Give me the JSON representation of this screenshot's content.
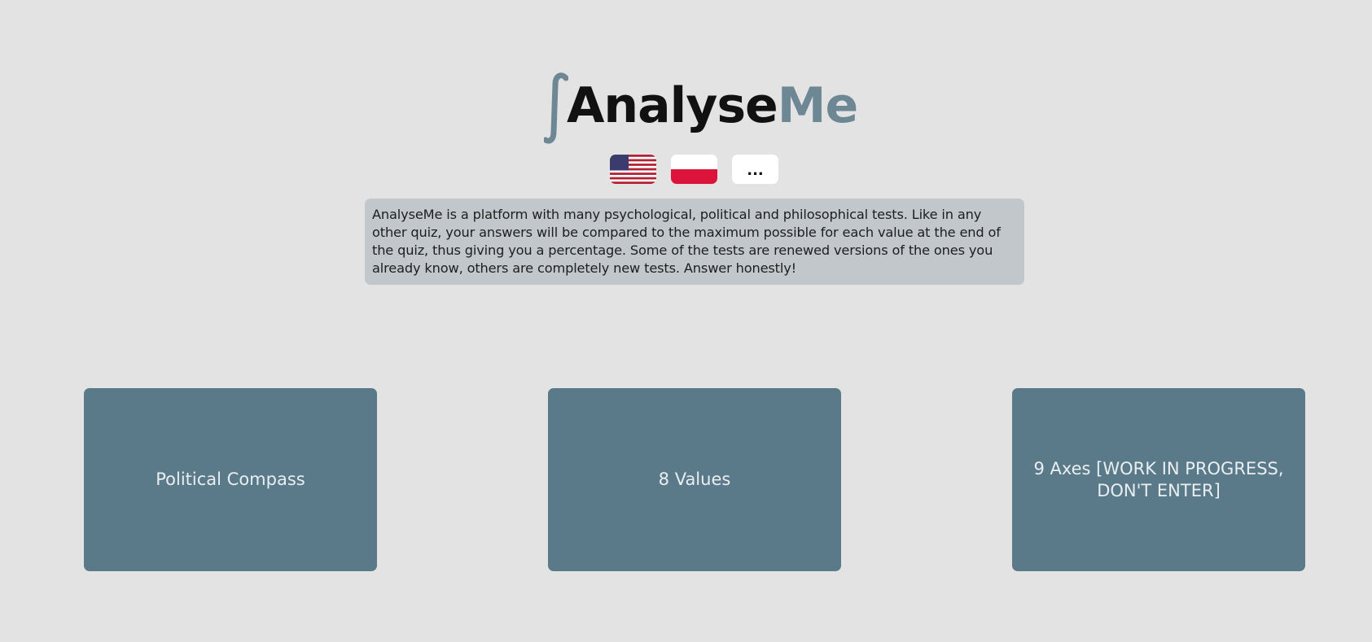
{
  "logo": {
    "glyph": "∫",
    "part1": "Analyse",
    "part2": "Me",
    "accent_color": "#6d8795",
    "text_color": "#111111"
  },
  "languages": [
    {
      "name": "english",
      "icon": "us-flag-icon"
    },
    {
      "name": "polish",
      "icon": "poland-flag-icon"
    },
    {
      "name": "more",
      "label": "..."
    }
  ],
  "description": "AnalyseMe is a platform with many psychological, political and philosophical tests. Like in any other quiz, your answers will be compared to the maximum possible for each value at the end of the quiz, thus giving you a percentage. Some of the tests are renewed versions of the ones you already know, others are completely new tests. Answer honestly!",
  "tests": [
    {
      "label": "Political Compass"
    },
    {
      "label": "8 Values"
    },
    {
      "label": "9 Axes [WORK IN PROGRESS, DON'T ENTER]"
    }
  ],
  "colors": {
    "background": "#e3e3e3",
    "card": "#5a7a8a",
    "card_text": "#e9eef1",
    "description_bg": "#c1c7cb"
  }
}
